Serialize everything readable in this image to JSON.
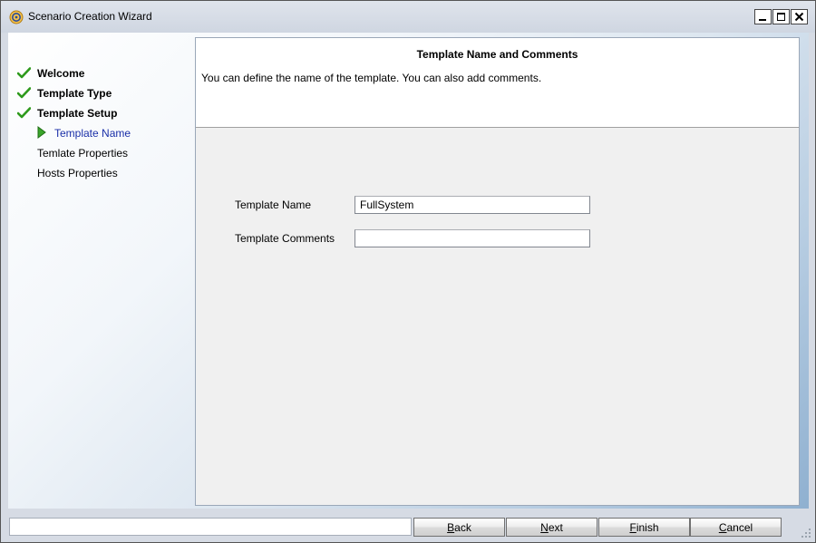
{
  "window": {
    "title": "Scenario Creation Wizard",
    "icon": "wizard-app-icon",
    "controls": {
      "minimize": "minimize-icon",
      "maximize": "maximize-icon",
      "close": "close-icon"
    }
  },
  "steps": [
    {
      "label": "Welcome",
      "state": "done"
    },
    {
      "label": "Template Type",
      "state": "done"
    },
    {
      "label": "Template Setup",
      "state": "done"
    },
    {
      "label": "Template Name",
      "state": "current"
    },
    {
      "label": "Temlate Properties",
      "state": "pending"
    },
    {
      "label": "Hosts Properties",
      "state": "pending"
    }
  ],
  "panel": {
    "title": "Template Name and Comments",
    "description": "You can define the name of the template. You can also add comments."
  },
  "form": {
    "name_label": "Template Name",
    "name_value": "FullSystem",
    "comments_label": "Template Comments",
    "comments_value": ""
  },
  "buttons": {
    "back_mnemonic": "B",
    "back_rest": "ack",
    "next_mnemonic": "N",
    "next_rest": "ext",
    "finish_mnemonic": "F",
    "finish_rest": "inish",
    "cancel_mnemonic": "C",
    "cancel_rest": "ancel"
  },
  "status": "",
  "colors": {
    "current_step": "#1a2fa8",
    "check": "#2e9a1c",
    "arrow": "#3aa52a"
  }
}
